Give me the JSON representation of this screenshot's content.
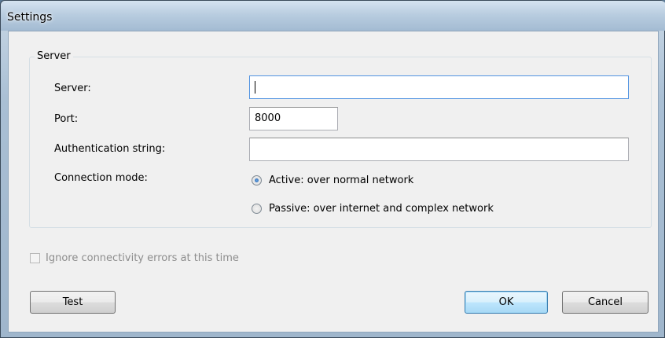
{
  "window": {
    "title": "Settings"
  },
  "server_group": {
    "title": "Server",
    "server_label": "Server:",
    "server_value": "",
    "port_label": "Port:",
    "port_value": "8000",
    "auth_label": "Authentication string:",
    "auth_value": "",
    "mode_label": "Connection mode:",
    "mode_options": [
      {
        "label": "Active: over normal network",
        "checked": true
      },
      {
        "label": "Passive: over internet and complex network",
        "checked": false
      }
    ]
  },
  "ignore_errors": {
    "label": "Ignore connectivity errors at this time",
    "checked": false,
    "enabled": false
  },
  "buttons": {
    "test": "Test",
    "ok": "OK",
    "cancel": "Cancel"
  }
}
